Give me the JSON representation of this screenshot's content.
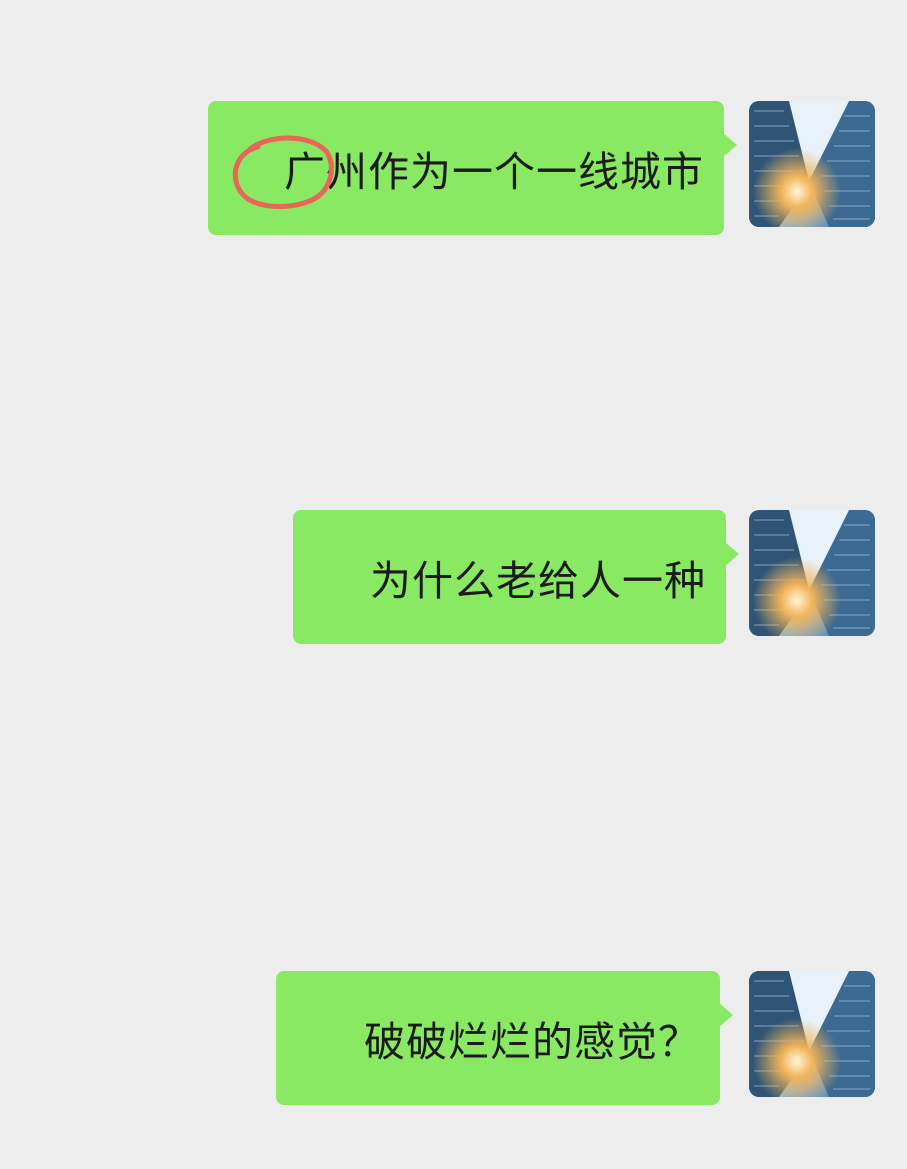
{
  "messages": [
    {
      "text": "广州作为一个一线城市",
      "avatar_icon": "city-skyscraper-avatar-icon"
    },
    {
      "text": "为什么老给人一种",
      "avatar_icon": "city-skyscraper-avatar-icon"
    },
    {
      "text": "破破烂烂的感觉？",
      "avatar_icon": "city-skyscraper-avatar-icon"
    }
  ],
  "colors": {
    "background": "#ededed",
    "bubble": "#89e962",
    "text": "#1b1b1b",
    "annotation": "#e8665a"
  }
}
